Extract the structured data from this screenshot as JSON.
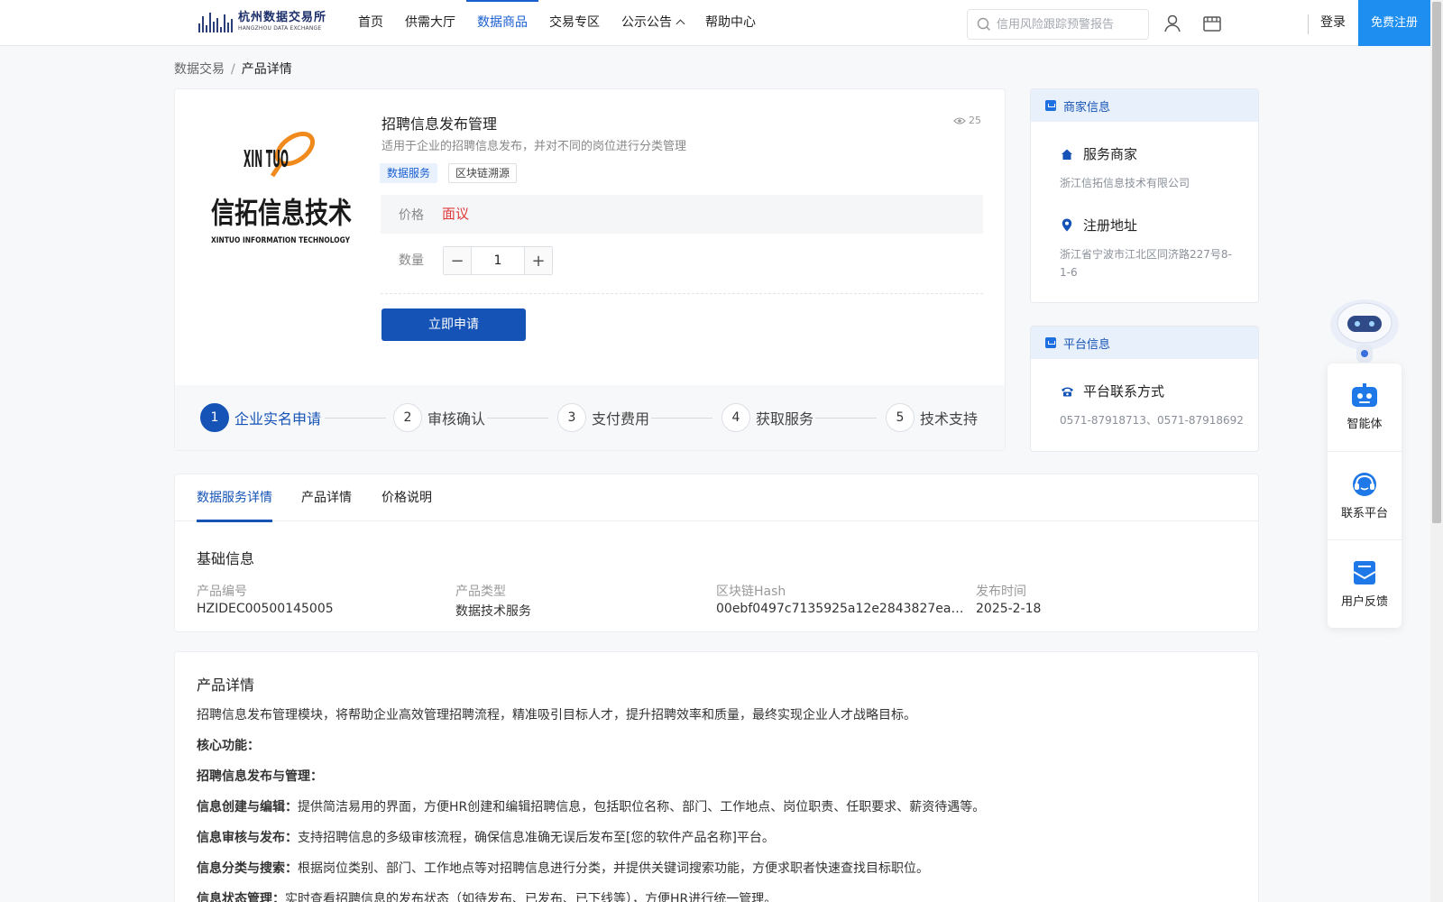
{
  "header": {
    "logo_cn": "杭州数据交易所",
    "logo_en": "HANGZHOU DATA EXCHANGE",
    "nav": [
      {
        "label": "首页"
      },
      {
        "label": "供需大厅"
      },
      {
        "label": "数据商品",
        "active": true
      },
      {
        "label": "交易专区"
      },
      {
        "label": "公示公告",
        "has_dropdown": true
      },
      {
        "label": "帮助中心"
      }
    ],
    "search_placeholder": "信用风险跟踪预警报告",
    "icons": [
      "search-icon",
      "user-icon",
      "store-icon"
    ],
    "login": "登录",
    "register": "免费注册"
  },
  "breadcrumb": {
    "root": "数据交易",
    "separator": "/",
    "current": "产品详情"
  },
  "product": {
    "logo_brand_latin": "XIN TUO",
    "logo_brand_cn": "信拓信息技术",
    "logo_brand_en": "XINTUO INFORMATION TECHNOLOGY",
    "title": "招聘信息发布管理",
    "views": "25",
    "description": "适用于企业的招聘信息发布，并对不同的岗位进行分类管理",
    "tags": [
      "数据服务",
      "区块链溯源"
    ],
    "price_label": "价格",
    "price_value": "面议",
    "qty_label": "数量",
    "qty_value": "1",
    "apply_button": "立即申请",
    "steps": [
      {
        "num": "1",
        "label": "企业实名申请",
        "active": true
      },
      {
        "num": "2",
        "label": "审核确认"
      },
      {
        "num": "3",
        "label": "支付费用"
      },
      {
        "num": "4",
        "label": "获取服务"
      },
      {
        "num": "5",
        "label": "技术支持"
      }
    ]
  },
  "merchant": {
    "heading": "商家信息",
    "service_title": "服务商家",
    "service_value": "浙江信拓信息技术有限公司",
    "address_title": "注册地址",
    "address_value": "浙江省宁波市江北区同济路227号8-1-6"
  },
  "platform": {
    "heading": "平台信息",
    "contact_title": "平台联系方式",
    "contact_value": "0571-87918713、0571-87918692"
  },
  "tabs": [
    {
      "label": "数据服务详情",
      "active": true
    },
    {
      "label": "产品详情"
    },
    {
      "label": "价格说明"
    }
  ],
  "basic_info": {
    "title": "基础信息",
    "fields": [
      {
        "label": "产品编号",
        "value": "HZIDEC00500145005"
      },
      {
        "label": "产品类型",
        "value": "数据技术服务"
      },
      {
        "label": "区块链Hash",
        "value": "00ebf0497c7135925a12e2843827eacff7c..."
      },
      {
        "label": "发布时间",
        "value": "2025-2-18"
      }
    ]
  },
  "detail": {
    "title": "产品详情",
    "intro": "招聘信息发布管理模块，将帮助企业高效管理招聘流程，精准吸引目标人才，提升招聘效率和质量，最终实现企业人才战略目标。",
    "core_label": "核心功能：",
    "sub_label": "招聘信息发布与管理：",
    "items": [
      {
        "k": "信息创建与编辑：",
        "v": "提供简洁易用的界面，方便HR创建和编辑招聘信息，包括职位名称、部门、工作地点、岗位职责、任职要求、薪资待遇等。"
      },
      {
        "k": "信息审核与发布：",
        "v": "支持招聘信息的多级审核流程，确保信息准确无误后发布至[您的软件产品名称]平台。"
      },
      {
        "k": "信息分类与搜索：",
        "v": "根据岗位类别、部门、工作地点等对招聘信息进行分类，并提供关键词搜索功能，方便求职者快速查找目标职位。"
      },
      {
        "k": "信息状态管理：",
        "v": "实时查看招聘信息的发布状态（如待发布、已发布、已下线等），方便HR进行统一管理。"
      }
    ]
  },
  "floating": [
    {
      "label": "智能体",
      "icon": "robot-icon"
    },
    {
      "label": "联系平台",
      "icon": "headset-icon"
    },
    {
      "label": "用户反馈",
      "icon": "feedback-icon"
    }
  ],
  "colors": {
    "primary": "#1553b6",
    "accent": "#1e8ff0",
    "price": "#e03a3a"
  }
}
